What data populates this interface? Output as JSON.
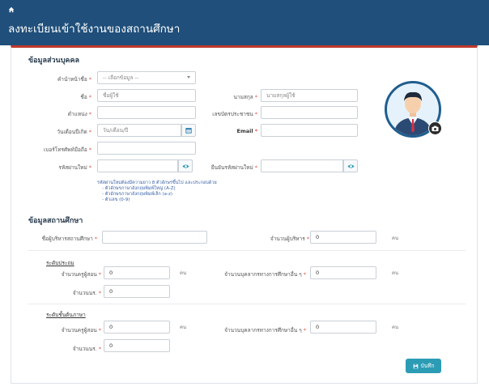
{
  "header": {
    "title": "ลงทะเบียนเข้าใช้งานของสถานศึกษา",
    "home_icon": "home-icon",
    "background": "#1f4f7a"
  },
  "personal": {
    "section_title": "ข้อมูลส่วนบุคคล",
    "prefix": {
      "label": "คำนำหน้าชื่อ",
      "placeholder": "-- เลือกข้อมูล --"
    },
    "first_name": {
      "label": "ชื่อ",
      "placeholder": "ชื่อผู้ใช้"
    },
    "last_name": {
      "label": "นามสกุล",
      "placeholder": "นามสกุลผู้ใช้"
    },
    "position": {
      "label": "ตำแหน่ง",
      "value": ""
    },
    "citizen_id": {
      "label": "เลขบัตรประชาชน",
      "value": ""
    },
    "birthdate": {
      "label": "วันเดือนปีเกิด",
      "placeholder": "วัน/เดือน/ปี"
    },
    "email": {
      "label": "Email",
      "value": ""
    },
    "phone": {
      "label": "เบอร์โทรศัพท์มือถือ",
      "value": ""
    },
    "new_password": {
      "label": "รหัสผ่านใหม่",
      "value": ""
    },
    "confirm_password": {
      "label": "ยืนยันรหัสผ่านใหม่",
      "value": ""
    },
    "password_hint": [
      "รหัสผ่านใหม่ต้องมีความยาว 8 ตัวอักษรขึ้นไป และประกอบด้วย",
      "- ตัวอักษรภาษาอังกฤษพิมพ์ใหญ่ (A-Z)",
      "- ตัวอักษรภาษาอังกฤษพิมพ์เล็ก (a-z)",
      "- ตัวเลข (0-9)"
    ]
  },
  "school": {
    "section_title": "ข้อมูลสถานศึกษา",
    "director_name": {
      "label": "ชื่อผู้บริหารสถานศึกษา",
      "value": ""
    },
    "admin_count": {
      "label": "จำนวนผู้บริหาร",
      "value": "0",
      "unit": "คน"
    },
    "primary": {
      "title": "ระดับประถม",
      "teachers": {
        "label": "จำนวนครูผู้สอน",
        "value": "0",
        "unit": "คน"
      },
      "other_staff": {
        "label": "จำนวนบุคลากรทางการศึกษาอื่น ๆ",
        "value": "0",
        "unit": "คน"
      },
      "students": {
        "label": "จำนวนนร.",
        "value": "0"
      }
    },
    "lower_secondary": {
      "title": "ระดับชั้นต้นภาษา",
      "teachers": {
        "label": "จำนวนครูผู้สอน",
        "value": "0",
        "unit": "คน"
      },
      "other_staff": {
        "label": "จำนวนบุคลากรทางการศึกษาอื่น ๆ",
        "value": "0",
        "unit": "คน"
      },
      "students": {
        "label": "จำนวนนร.",
        "value": "0"
      }
    }
  },
  "actions": {
    "save_label": "บันทึก"
  },
  "required_marker": "*",
  "colors": {
    "accent": "#2c9cb5",
    "required": "#e74c3c",
    "panel_top": "#c0392b"
  }
}
